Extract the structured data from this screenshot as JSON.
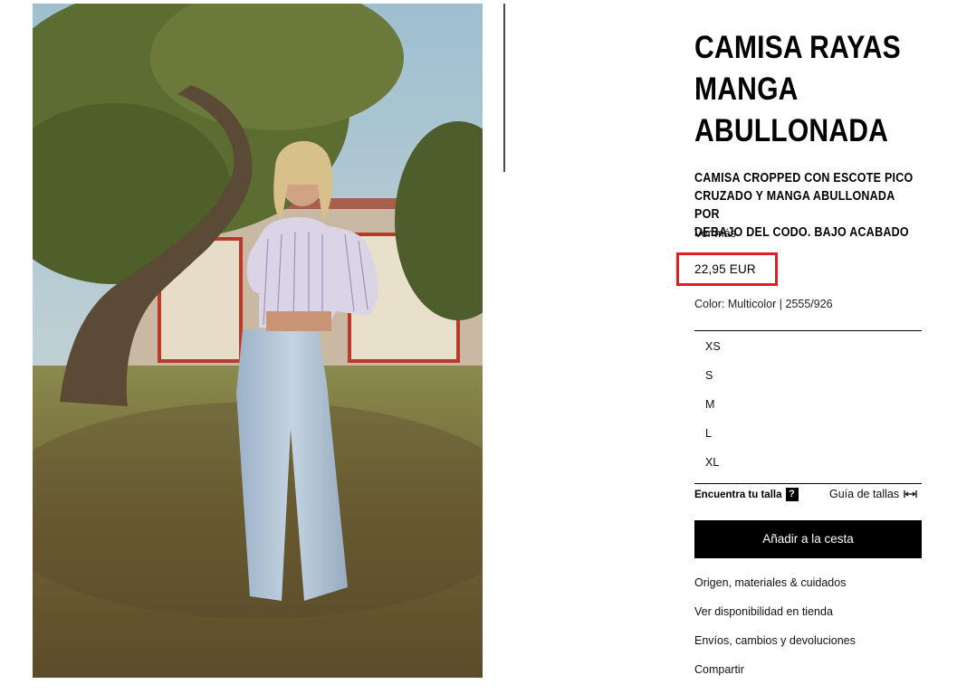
{
  "product": {
    "title_lines": [
      "CAMISA RAYAS",
      "MANGA",
      "ABULLONADA"
    ],
    "description_lines": [
      "CAMISA CROPPED CON ESCOTE PICO",
      "CRUZADO Y MANGA ABULLONADA POR",
      "DEBAJO DEL CODO. BAJO ACABADO"
    ],
    "see_more": "Ver más",
    "price": "22,95 EUR",
    "color_line": "Color: Multicolor | 2555/926",
    "image_icon": "product-photo"
  },
  "sizes": [
    "XS",
    "S",
    "M",
    "L",
    "XL"
  ],
  "size_tools": {
    "find_size": "Encuentra tu talla",
    "find_icon": "?",
    "size_guide": "Guía de tallas",
    "guide_icon": "ruler-arrows-icon"
  },
  "cart": {
    "label": "Añadir a la cesta"
  },
  "links": [
    "Origen, materiales & cuidados",
    "Ver disponibilidad en tienda",
    "Envíos, cambios y devoluciones",
    "Compartir"
  ],
  "colors": {
    "highlight": "#dd2026",
    "button_bg": "#000000",
    "button_text": "#ffffff"
  }
}
